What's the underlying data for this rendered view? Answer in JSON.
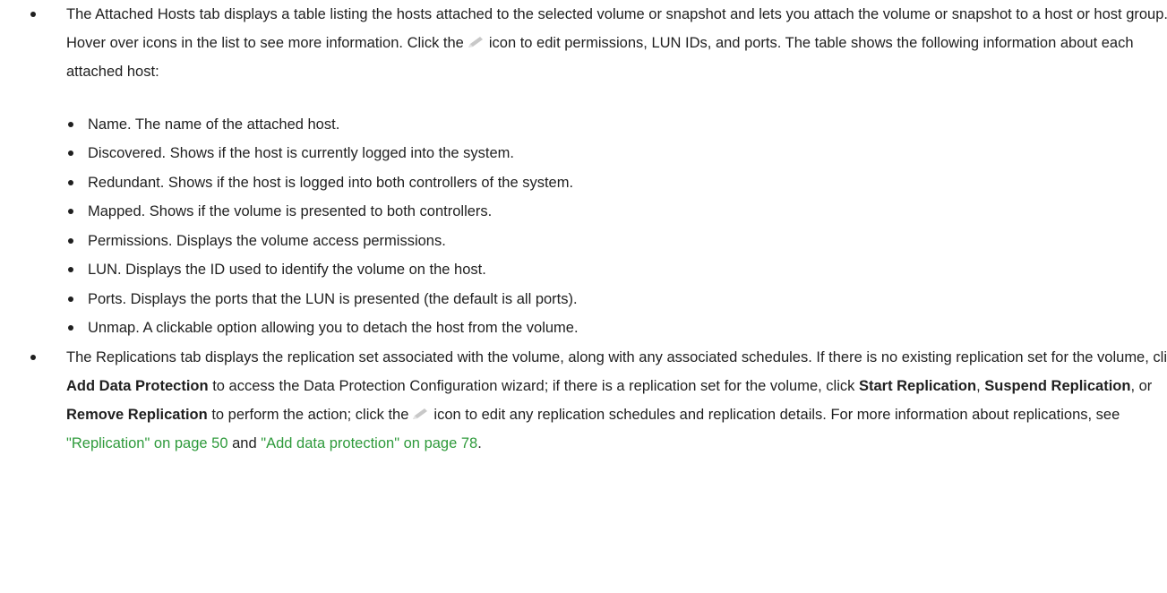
{
  "attached_hosts": {
    "part1": "The Attached Hosts tab displays a table listing the hosts attached to the selected volume or snapshot and lets you attach the volume or snapshot to a host or host group. Hover over icons in the list to see more information. Click the",
    "part2": "icon to edit permissions, LUN IDs, and ports. The table shows the following information about each attached host:",
    "icon": "pencil-icon",
    "items": [
      "Name. The name of the attached host.",
      "Discovered. Shows if the host is currently logged into the system.",
      "Redundant. Shows if the host is logged into both controllers of the system.",
      "Mapped. Shows if the volume is presented to both controllers.",
      "Permissions. Displays the volume access permissions.",
      "LUN. Displays the ID used to identify the volume on the host.",
      "Ports. Displays the ports that the LUN is presented (the default is all ports).",
      "Unmap. A clickable option allowing you to detach the host from the volume."
    ]
  },
  "replications": {
    "part1": "The Replications tab displays the replication set associated with the volume, along with any associated schedules. If there is no existing replication set for the volume, click",
    "add_data_protection": "Add Data Protection",
    "part2": "to access the Data Protection Configuration wizard; if there is a replication set for the volume, click",
    "start_replication": "Start Replication",
    "sep1": ",",
    "suspend_replication": "Suspend Replication",
    "sep2": ", or",
    "remove_replication": "Remove Replication",
    "part3": "to perform the action; click the",
    "part4": "icon to edit any replication schedules and replication details. For more information about replications, see",
    "link1": "\"Replication\" on page 50",
    "and": "and",
    "link2": "\"Add data protection\" on page 78",
    "end": "."
  },
  "colors": {
    "text": "#1f1f1f",
    "link": "#2e9a3b",
    "icon": "#c8c8c8"
  }
}
